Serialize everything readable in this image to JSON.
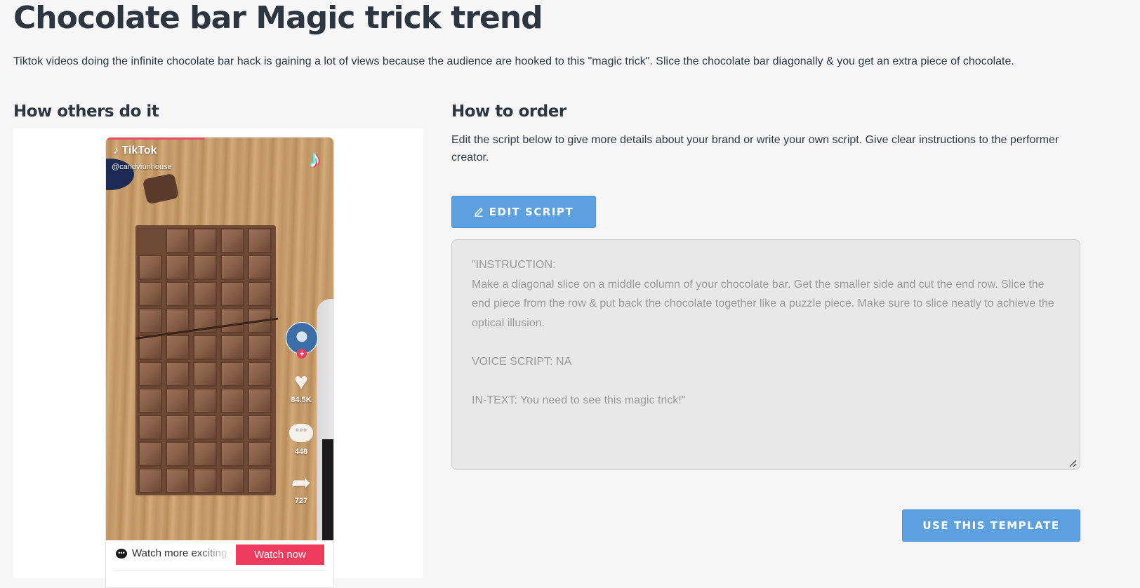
{
  "page": {
    "title": "Chocolate bar Magic trick trend",
    "intro": "Tiktok videos doing the infinite chocolate bar hack is gaining a lot of views because the audience are hooked to this \"magic trick\". Slice the chocolate bar diagonally & you get an extra piece of chocolate."
  },
  "left": {
    "heading": "How others do it",
    "tiktok": {
      "brand": "TikTok",
      "handle": "@candyfunhouse",
      "likes": "84.5K",
      "comments": "448",
      "shares": "727",
      "footer_text": "Watch more exciting videos on TikTok",
      "watch_button": "Watch now",
      "accent": "#ee3b5e"
    }
  },
  "right": {
    "heading": "How to order",
    "description": "Edit the script below to give more details about your brand or write your own script. Give clear instructions to the performer creator.",
    "edit_button": "EDIT SCRIPT",
    "script": "\"INSTRUCTION:\nMake a diagonal slice on a middle column of your chocolate bar. Get the smaller side and cut the end row. Slice the end piece from the row & put back the chocolate together like a puzzle piece. Make sure to slice neatly to achieve the optical illusion.\n\nVOICE SCRIPT: NA\n\nIN-TEXT: You need to see this magic trick!\"",
    "use_button": "USE THIS TEMPLATE",
    "button_color": "#5da0e0"
  },
  "icons": {
    "pencil": "pencil-icon",
    "tiktok_logo": "tiktok-logo-icon",
    "heart": "heart-icon",
    "comment": "comment-icon",
    "share": "share-icon",
    "chat": "chat-bubble-icon"
  }
}
